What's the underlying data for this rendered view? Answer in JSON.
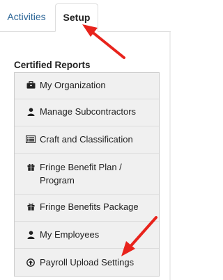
{
  "tabs": {
    "activities_label": "Activities",
    "setup_label": "Setup"
  },
  "section": {
    "title": "Certified Reports"
  },
  "menu": {
    "items": [
      {
        "label": "My Organization",
        "icon": "briefcase-icon"
      },
      {
        "label": "Manage Subcontractors",
        "icon": "user-icon"
      },
      {
        "label": "Craft and Classification",
        "icon": "list-icon"
      },
      {
        "label": "Fringe Benefit Plan / Program",
        "icon": "gift-icon"
      },
      {
        "label": "Fringe Benefits Package",
        "icon": "gift-icon"
      },
      {
        "label": "My Employees",
        "icon": "user-icon"
      },
      {
        "label": "Payroll Upload Settings",
        "icon": "upload-circle-icon"
      }
    ]
  },
  "colors": {
    "accent_link": "#2a6496",
    "annotation_arrow": "#e8231c",
    "menu_background": "#f0f0f0"
  }
}
